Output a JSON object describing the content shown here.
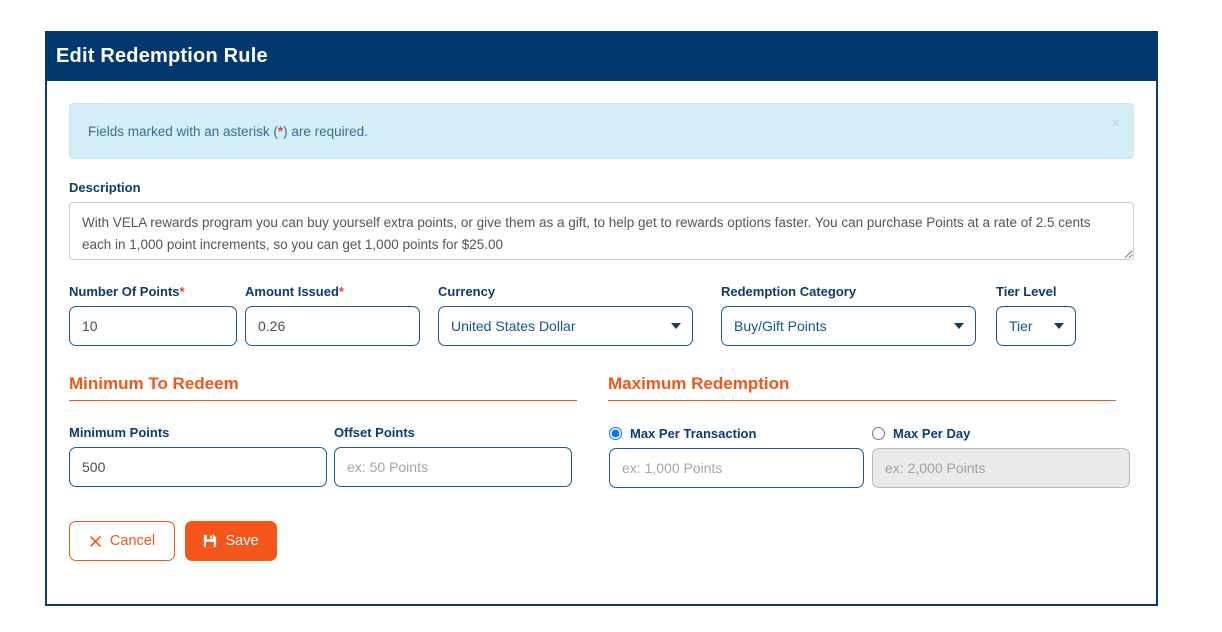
{
  "header": {
    "title": "Edit Redemption Rule"
  },
  "alert": {
    "text_before": "Fields marked with an asterisk (",
    "asterisk": "*",
    "text_after": ") are required.",
    "close_label": "×"
  },
  "description": {
    "label": "Description",
    "value": "With VELA rewards program you can buy yourself extra points, or give them as a gift, to help get to rewards options faster. You can purchase Points at a rate of 2.5 cents each in 1,000 point increments, so you can get 1,000 points for $25.00"
  },
  "fields": {
    "number_of_points": {
      "label": "Number Of Points",
      "required": "*",
      "value": "10"
    },
    "amount_issued": {
      "label": "Amount Issued",
      "required": "*",
      "value": "0.26"
    },
    "currency": {
      "label": "Currency",
      "value": "United States Dollar",
      "options": [
        "United States Dollar"
      ]
    },
    "redemption_category": {
      "label": "Redemption Category",
      "value": "Buy/Gift Points",
      "options": [
        "Buy/Gift Points"
      ]
    },
    "tier_level": {
      "label": "Tier Level",
      "value": "Tier",
      "options": [
        "Tier"
      ]
    }
  },
  "minimum_to_redeem": {
    "section_title": "Minimum To Redeem",
    "minimum_points": {
      "label": "Minimum Points",
      "value": "500",
      "placeholder": ""
    },
    "offset_points": {
      "label": "Offset Points",
      "value": "",
      "placeholder": "ex: 50 Points"
    }
  },
  "maximum_redemption": {
    "section_title": "Maximum Redemption",
    "max_per_transaction": {
      "label": "Max Per Transaction",
      "selected": true,
      "value": "",
      "placeholder": "ex: 1,000 Points"
    },
    "max_per_day": {
      "label": "Max Per Day",
      "selected": false,
      "value": "",
      "placeholder": "ex: 2,000 Points",
      "disabled": true
    }
  },
  "buttons": {
    "cancel": "Cancel",
    "save": "Save"
  },
  "colors": {
    "header_navy": "#02386e",
    "panel_border": "#0b3c6b",
    "accent_orange": "#f4561a",
    "alert_bg": "#d4eef7",
    "alert_text": "#31708f",
    "required_red": "#e8403a",
    "input_border": "#1b5c92"
  }
}
